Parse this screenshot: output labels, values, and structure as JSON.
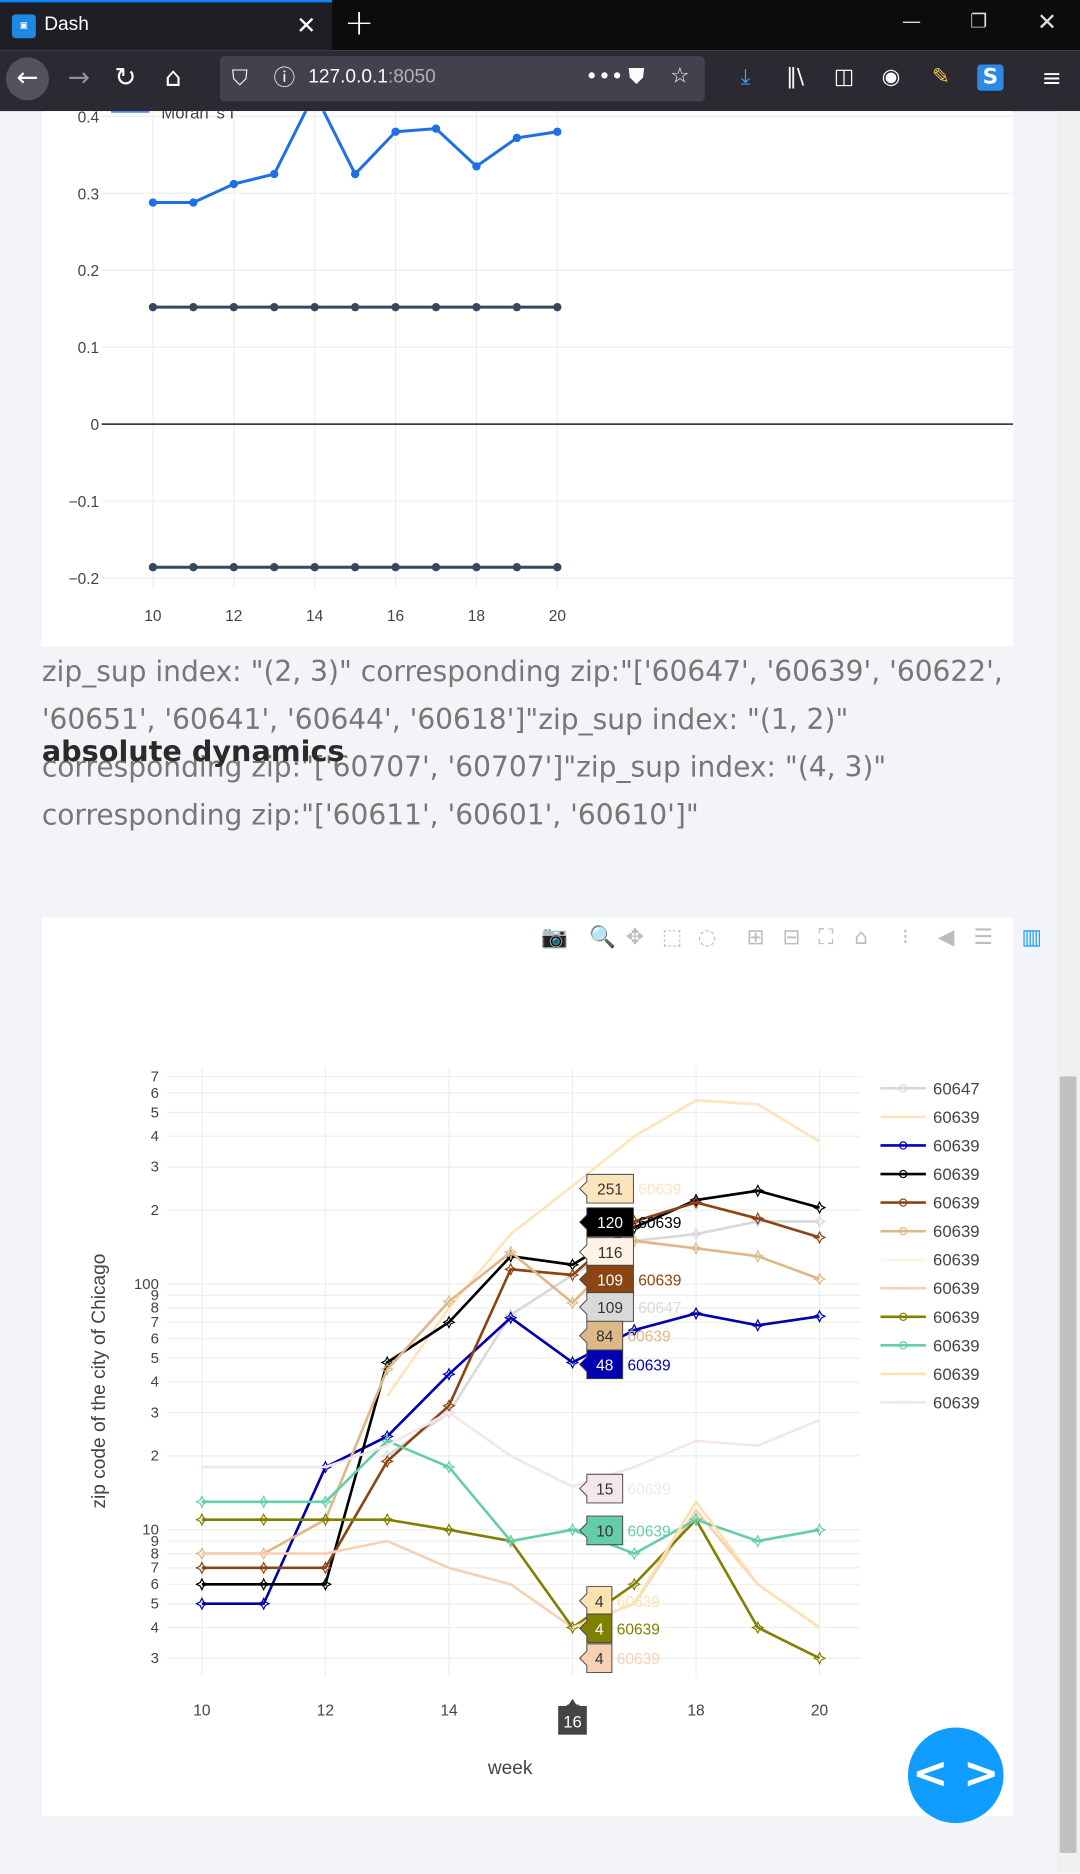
{
  "browser": {
    "tab_title": "Dash",
    "tab_favicon": "dash-favicon",
    "url_host": "127.0.0.1",
    "url_port": ":8050"
  },
  "top_chart": {
    "legend_fragment": "Moran' s I",
    "y_ticks": [
      "0.4",
      "0.3",
      "0.2",
      "0.1",
      "0",
      "−0.1",
      "−0.2"
    ],
    "x_ticks": [
      "10",
      "12",
      "14",
      "16",
      "18",
      "20"
    ]
  },
  "zip_text": "zip_sup index: \"(2, 3)\" corresponding zip:\"['60647', '60639', '60622', '60651', '60641', '60644', '60618']\"zip_sup index: \"(1, 2)\" corresponding zip:\"['60707', '60707']\"zip_sup index: \"(4, 3)\" corresponding zip:\"['60611', '60601', '60610']\"",
  "section_title": "absolute dynamics",
  "chart_data": [
    {
      "type": "line",
      "x": [
        10,
        11,
        12,
        13,
        14,
        15,
        16,
        17,
        18,
        19,
        20
      ],
      "ylim": [
        -0.2,
        0.4
      ],
      "grid": true,
      "series": [
        {
          "name": "Moran' s I",
          "color": "#1f6fe5",
          "values": [
            0.288,
            0.288,
            0.312,
            0.325,
            0.43,
            0.325,
            0.38,
            0.384,
            0.335,
            0.372,
            0.38
          ]
        },
        {
          "color": "#34495e",
          "values": [
            0.152,
            0.152,
            0.152,
            0.152,
            0.152,
            0.152,
            0.152,
            0.152,
            0.152,
            0.152,
            0.152
          ]
        },
        {
          "color": "#34495e",
          "values": [
            -0.186,
            -0.186,
            -0.186,
            -0.186,
            -0.186,
            -0.186,
            -0.186,
            -0.186,
            -0.186,
            -0.186,
            -0.186
          ]
        }
      ]
    },
    {
      "type": "line",
      "log_y": true,
      "xlabel": "week",
      "ylabel": "zip code of the city of Chicago",
      "x": [
        10,
        11,
        12,
        13,
        14,
        15,
        16,
        17,
        18,
        19,
        20
      ],
      "x_ticks": [
        "10",
        "12",
        "14",
        "16",
        "18",
        "20"
      ],
      "y_ticks": [
        "3",
        "4",
        "5",
        "6",
        "7",
        "8",
        "9",
        "10",
        "2",
        "3",
        "4",
        "5",
        "6",
        "7",
        "8",
        "9",
        "100",
        "2",
        "3",
        "4",
        "5",
        "6",
        "7"
      ],
      "hover_x": "16",
      "legend_position": "right",
      "series": [
        {
          "name": "60647",
          "color": "#d9d9d9",
          "marker": true,
          "values": [
            null,
            null,
            null,
            20,
            30,
            75,
            109,
            150,
            160,
            180,
            180
          ]
        },
        {
          "name": "60639",
          "color": "#fce5bd",
          "marker": false,
          "values": [
            null,
            null,
            null,
            35,
            80,
            160,
            251,
            400,
            560,
            540,
            380
          ]
        },
        {
          "name": "60639",
          "color": "#0000b0",
          "marker": true,
          "values": [
            5,
            5,
            18,
            24,
            43,
            73,
            48,
            65,
            76,
            68,
            74
          ]
        },
        {
          "name": "60639",
          "color": "#000000",
          "marker": true,
          "values": [
            6,
            6,
            6,
            48,
            70,
            130,
            120,
            170,
            220,
            240,
            205
          ]
        },
        {
          "name": "60639",
          "color": "#8b4513",
          "marker": true,
          "values": [
            7,
            7,
            7,
            19,
            32,
            115,
            109,
            180,
            215,
            185,
            155
          ]
        },
        {
          "name": "60639",
          "color": "#deb887",
          "marker": true,
          "values": [
            8,
            8,
            11,
            45,
            85,
            135,
            84,
            150,
            140,
            130,
            105
          ]
        },
        {
          "name": "60639",
          "color": "#fff3e6",
          "marker": false,
          "values": [
            null,
            null,
            null,
            null,
            null,
            null,
            null,
            null,
            null,
            null,
            null
          ]
        },
        {
          "name": "60639",
          "color": "#f8d0b4",
          "marker": false,
          "values": [
            8,
            8,
            8,
            9,
            7,
            6,
            4,
            5,
            12,
            6,
            4
          ]
        },
        {
          "name": "60639",
          "color": "#808000",
          "marker": true,
          "values": [
            11,
            11,
            11,
            11,
            10,
            9,
            4,
            6,
            11,
            4,
            3
          ]
        },
        {
          "name": "60639",
          "color": "#66cdaa",
          "marker": true,
          "values": [
            13,
            13,
            13,
            23,
            18,
            9,
            10,
            8,
            11,
            9,
            10
          ]
        },
        {
          "name": "60639",
          "color": "#fbe2b0",
          "marker": false,
          "values": [
            null,
            null,
            null,
            null,
            null,
            null,
            4,
            5,
            13,
            6,
            4
          ]
        },
        {
          "name": "60639",
          "color": "#f4e6ec",
          "marker": false,
          "values": [
            18,
            18,
            18,
            22,
            30,
            20,
            15,
            18,
            23,
            22,
            28
          ]
        }
      ],
      "hover_labels": [
        {
          "value": "251",
          "name": "60639",
          "bg": "#fce5bd",
          "fg": "#333",
          "name_color": "#fce5bd"
        },
        {
          "value": "120",
          "name": "60639",
          "bg": "#000000",
          "fg": "#ffffff",
          "name_color": "#000000"
        },
        {
          "value": "116",
          "name": "",
          "bg": "#fff3e6",
          "fg": "#333",
          "name_color": "#fff3e6"
        },
        {
          "value": "109",
          "name": "60639",
          "bg": "#8b4513",
          "fg": "#ffffff",
          "name_color": "#8b4513"
        },
        {
          "value": "109",
          "name": "60647",
          "bg": "#d9d9d9",
          "fg": "#333",
          "name_color": "#d9d9d9"
        },
        {
          "value": "84",
          "name": "60639",
          "bg": "#deb887",
          "fg": "#333",
          "name_color": "#deb887"
        },
        {
          "value": "48",
          "name": "60639",
          "bg": "#0000b0",
          "fg": "#ffffff",
          "name_color": "#0000b0"
        },
        {
          "value": "15",
          "name": "60639",
          "bg": "#f4e6ec",
          "fg": "#333",
          "name_color": "#f4e6ec"
        },
        {
          "value": "10",
          "name": "60639",
          "bg": "#66cdaa",
          "fg": "#333",
          "name_color": "#66cdaa"
        },
        {
          "value": "4",
          "name": "60639",
          "bg": "#fbe2b0",
          "fg": "#333",
          "name_color": "#fbe2b0"
        },
        {
          "value": "4",
          "name": "60639",
          "bg": "#808000",
          "fg": "#ffffff",
          "name_color": "#808000"
        },
        {
          "value": "4",
          "name": "60639",
          "bg": "#f8d0b4",
          "fg": "#333",
          "name_color": "#f8d0b4"
        }
      ]
    }
  ],
  "modebar_icons": [
    "camera-icon",
    "zoom-icon",
    "pan-icon",
    "box-select-icon",
    "lasso-icon",
    "zoom-in-icon",
    "zoom-out-icon",
    "autoscale-icon",
    "reset-axes-icon",
    "spike-lines-icon",
    "hover-closest-icon",
    "hover-compare-icon",
    "plotly-logo-icon"
  ],
  "fab_label": "< >"
}
